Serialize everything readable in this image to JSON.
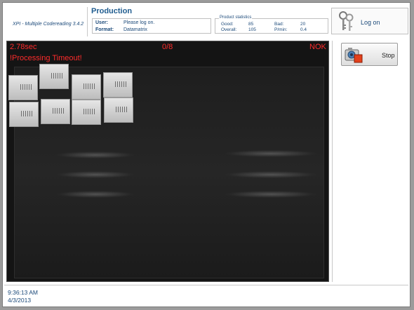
{
  "header": {
    "app_name": "XPI - Multiple Codereading 3.4.2",
    "page_title": "Production",
    "user_label": "User:",
    "user_value": "Please log on.",
    "format_label": "Format:",
    "format_value": "Datamatrix",
    "stats_title": "Product statistics",
    "good_label": "Good:",
    "good_value": "85",
    "bad_label": "Bad:",
    "bad_value": "20",
    "overall_label": "Overall:",
    "overall_value": "105",
    "percent_label": "P/min:",
    "percent_value": "0.4",
    "logon_label": "Log on"
  },
  "camera": {
    "cycle_time": "2.78sec",
    "count": "0/8",
    "result": "NOK",
    "message": "!Processing Timeout!"
  },
  "actions": {
    "stop_label": "Stop"
  },
  "footer": {
    "time": "9:36:13 AM",
    "date": "4/3/2013"
  },
  "colors": {
    "accent": "#1f5c8f",
    "error": "#ff2b2b"
  }
}
